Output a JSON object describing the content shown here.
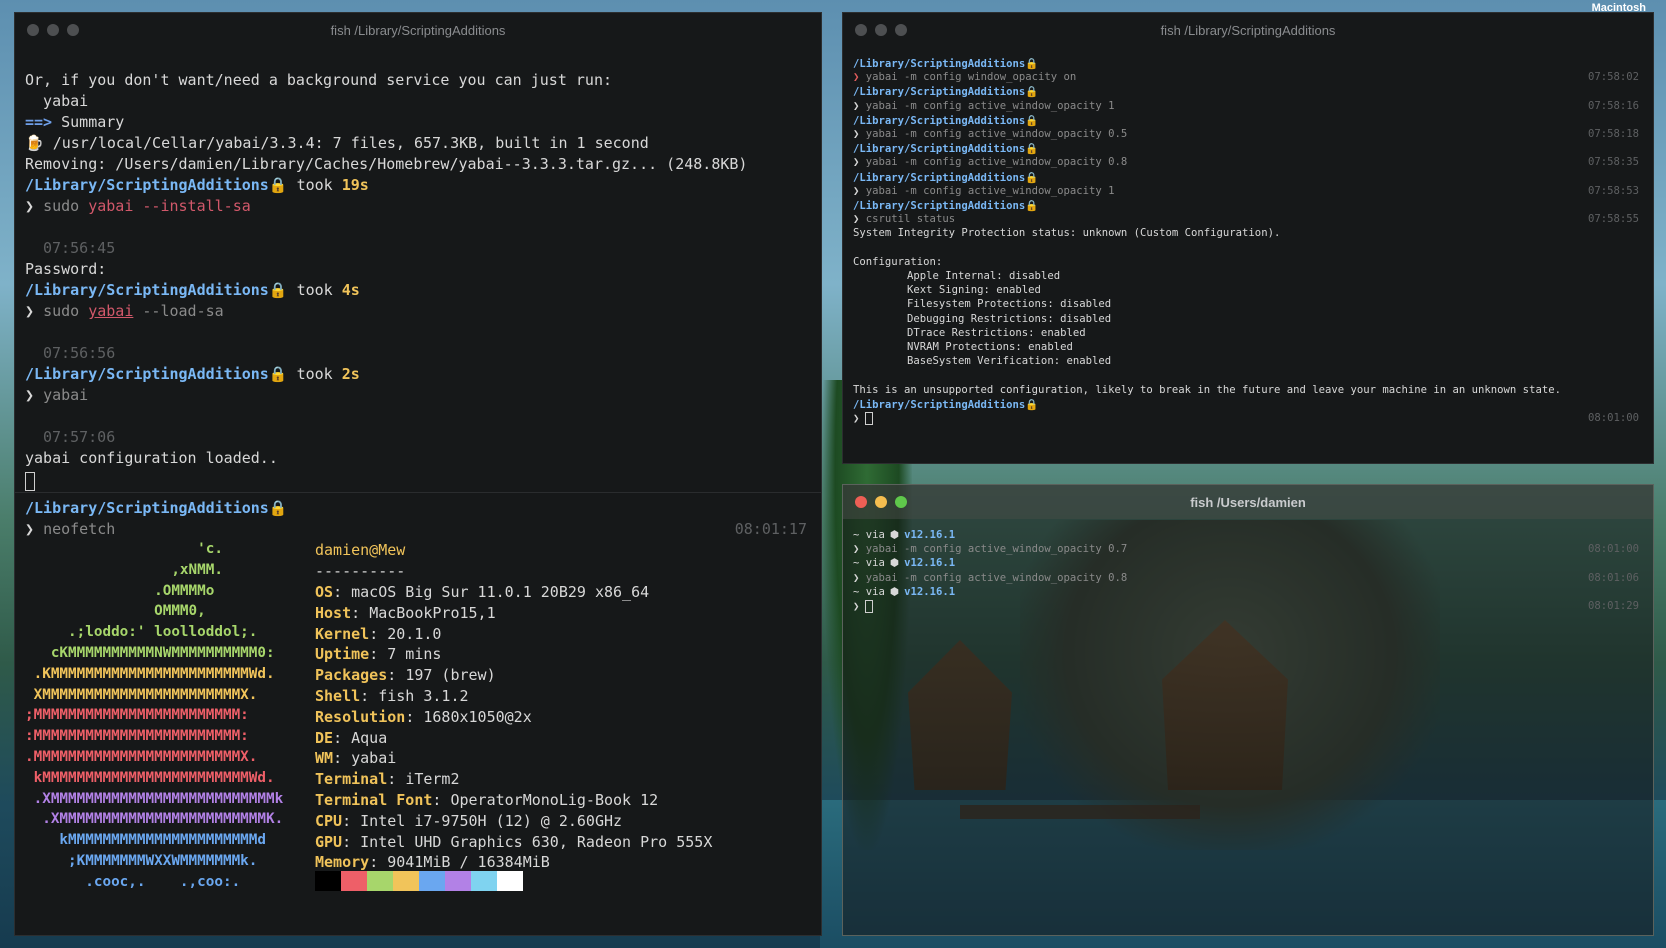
{
  "wallpaper": {
    "label": "Macintosh"
  },
  "win1": {
    "title": "fish /Library/ScriptingAdditions",
    "lines": [
      "Or, if you don't want/need a background service you can just run:",
      "  yabai",
      "Summary",
      "/usr/local/Cellar/yabai/3.3.4: 7 files, 657.3KB, built in 1 second",
      "Removing: /Users/damien/Library/Caches/Homebrew/yabai--3.3.3.tar.gz... (248.8KB)"
    ],
    "summary_arrow": "==>",
    "beer_icon": "🍺",
    "prompt_path": "/Library/ScriptingAdditions",
    "took_label": "took",
    "arrow": "❯",
    "block1": {
      "dur": "19s",
      "sudo": "sudo",
      "bin": "yabai",
      "args": "--install-sa",
      "ts": "07:56:45",
      "out": "Password:"
    },
    "block2": {
      "dur": "4s",
      "sudo": "sudo",
      "bin": "yabai",
      "args": "--load-sa",
      "ts": "07:56:56"
    },
    "block3": {
      "dur": "2s",
      "cmd": "yabai",
      "ts": "07:57:06",
      "out": "yabai configuration loaded.."
    },
    "pane2": {
      "cmd": "neofetch",
      "ts": "08:01:17"
    },
    "neofetch": {
      "logo": [
        {
          "t": "                    'c.",
          "c": "#a7d66b"
        },
        {
          "t": "                 ,xNMM.",
          "c": "#a7d66b"
        },
        {
          "t": "               .OMMMMo",
          "c": "#a7d66b"
        },
        {
          "t": "               OMMM0,",
          "c": "#a7d66b"
        },
        {
          "t": "     .;loddo:' loolloddol;.",
          "c": "#a7d66b"
        },
        {
          "t": "   cKMMMMMMMMMMNWMMMMMMMMMM0:",
          "c": "#a7d66b"
        },
        {
          "t": " .KMMMMMMMMMMMMMMMMMMMMMMMWd.",
          "c": "#f1c45a"
        },
        {
          "t": " XMMMMMMMMMMMMMMMMMMMMMMMX.",
          "c": "#f1c45a"
        },
        {
          "t": ";MMMMMMMMMMMMMMMMMMMMMMMM:",
          "c": "#ee5f68"
        },
        {
          "t": ":MMMMMMMMMMMMMMMMMMMMMMMM:",
          "c": "#ee5f68"
        },
        {
          "t": ".MMMMMMMMMMMMMMMMMMMMMMMMX.",
          "c": "#ee5f68"
        },
        {
          "t": " kMMMMMMMMMMMMMMMMMMMMMMMMWd.",
          "c": "#ee5f68"
        },
        {
          "t": " .XMMMMMMMMMMMMMMMMMMMMMMMMMMk",
          "c": "#b281e6"
        },
        {
          "t": "  .XMMMMMMMMMMMMMMMMMMMMMMMMK.",
          "c": "#b281e6"
        },
        {
          "t": "    kMMMMMMMMMMMMMMMMMMMMMMd",
          "c": "#6aa7f0"
        },
        {
          "t": "     ;KMMMMMMMWXXWMMMMMMMk.",
          "c": "#6aa7f0"
        },
        {
          "t": "       .cooc,.    .,coo:.",
          "c": "#6aa7f0"
        }
      ],
      "user": "damien@Mew",
      "sep": "----------",
      "info": [
        {
          "k": "OS",
          "v": "macOS Big Sur 11.0.1 20B29 x86_64"
        },
        {
          "k": "Host",
          "v": "MacBookPro15,1"
        },
        {
          "k": "Kernel",
          "v": "20.1.0"
        },
        {
          "k": "Uptime",
          "v": "7 mins"
        },
        {
          "k": "Packages",
          "v": "197 (brew)"
        },
        {
          "k": "Shell",
          "v": "fish 3.1.2"
        },
        {
          "k": "Resolution",
          "v": "1680x1050@2x"
        },
        {
          "k": "DE",
          "v": "Aqua"
        },
        {
          "k": "WM",
          "v": "yabai"
        },
        {
          "k": "Terminal",
          "v": "iTerm2"
        },
        {
          "k": "Terminal Font",
          "v": "OperatorMonoLig-Book 12"
        },
        {
          "k": "CPU",
          "v": "Intel i7-9750H (12) @ 2.60GHz"
        },
        {
          "k": "GPU",
          "v": "Intel UHD Graphics 630, Radeon Pro 555X"
        },
        {
          "k": "Memory",
          "v": "9041MiB / 16384MiB"
        }
      ],
      "swatches": [
        "#000000",
        "#ee5f68",
        "#a7d66b",
        "#f1c45a",
        "#6aa7f0",
        "#b281e6",
        "#7fd3f0",
        "#ffffff"
      ]
    }
  },
  "win2": {
    "title": "fish /Library/ScriptingAdditions",
    "path": "/Library/ScriptingAdditions",
    "cmds": [
      {
        "c": "yabai -m config window_opacity on",
        "ts": "07:58:02"
      },
      {
        "c": "yabai -m config active_window_opacity 1",
        "ts": "07:58:16"
      },
      {
        "c": "yabai -m config active_window_opacity 0.5",
        "ts": "07:58:18"
      },
      {
        "c": "yabai -m config active_window_opacity 0.8",
        "ts": "07:58:35"
      },
      {
        "c": "yabai -m config active_window_opacity 1",
        "ts": "07:58:53"
      }
    ],
    "csr": {
      "c": "csrutil status",
      "ts": "07:58:55"
    },
    "sip": "System Integrity Protection status: unknown (Custom Configuration).",
    "config_label": "Configuration:",
    "config": [
      "Apple Internal: disabled",
      "Kext Signing: enabled",
      "Filesystem Protections: disabled",
      "Debugging Restrictions: disabled",
      "DTrace Restrictions: enabled",
      "NVRAM Protections: enabled",
      "BaseSystem Verification: enabled"
    ],
    "warning": "This is an unsupported configuration, likely to break in the future and leave your machine in an unknown state.",
    "last_ts": "08:01:00"
  },
  "win3": {
    "title": "fish /Users/damien",
    "rows": [
      {
        "via": "~ via",
        "ver": "v12.16.1",
        "cmd": "yabai -m config active_window_opacity 0.7",
        "ts": "08:01:00"
      },
      {
        "via": "~ via",
        "ver": "v12.16.1",
        "cmd": "yabai -m config active_window_opacity 0.8",
        "ts": "08:01:06"
      }
    ],
    "last": {
      "via": "~ via",
      "ver": "v12.16.1",
      "ts": "08:01:29"
    }
  }
}
